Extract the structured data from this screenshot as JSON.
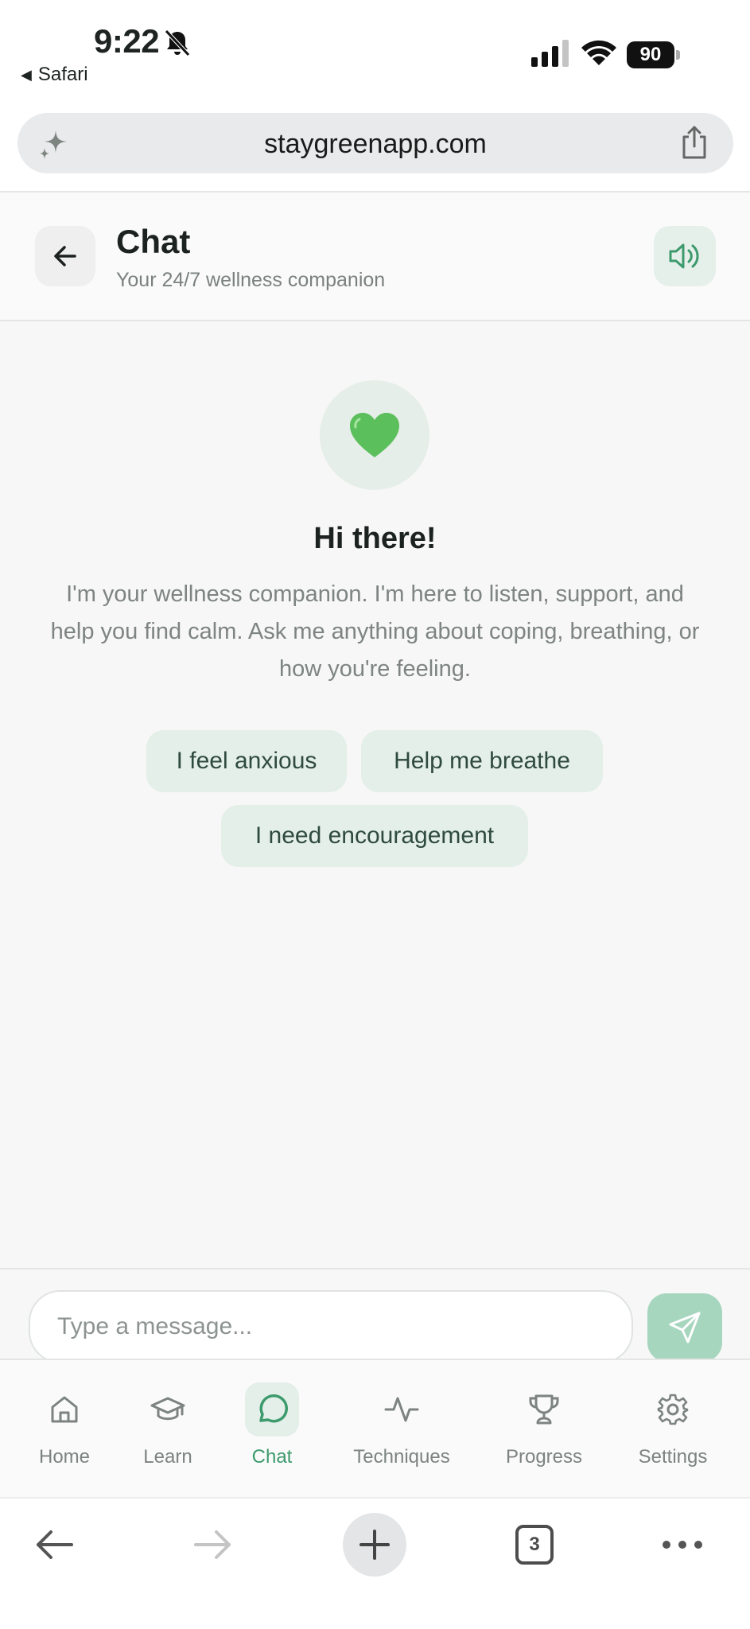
{
  "status_bar": {
    "time": "9:22",
    "back_app": "Safari",
    "battery": "90"
  },
  "browser": {
    "url": "staygreenapp.com",
    "tab_count": "3"
  },
  "header": {
    "title": "Chat",
    "subtitle": "Your 24/7 wellness companion"
  },
  "welcome": {
    "emoji": "💚",
    "title": "Hi there!",
    "message": "I'm your wellness companion. I'm here to listen, support, and help you find calm. Ask me anything about coping, breathing, or how you're feeling."
  },
  "suggestions": [
    {
      "label": "I feel anxious"
    },
    {
      "label": "Help me breathe"
    },
    {
      "label": "I need encouragement"
    }
  ],
  "composer": {
    "placeholder": "Type a message..."
  },
  "nav": [
    {
      "label": "Home",
      "icon": "home-icon"
    },
    {
      "label": "Learn",
      "icon": "graduation-cap-icon"
    },
    {
      "label": "Chat",
      "icon": "chat-bubble-icon",
      "active": true
    },
    {
      "label": "Techniques",
      "icon": "pulse-icon"
    },
    {
      "label": "Progress",
      "icon": "trophy-icon"
    },
    {
      "label": "Settings",
      "icon": "gear-icon"
    }
  ],
  "colors": {
    "accent": "#3d9a6c",
    "chip_bg": "#e3efe8",
    "send_bg": "#a7d6bf",
    "page_bg": "#f6f7f6"
  }
}
